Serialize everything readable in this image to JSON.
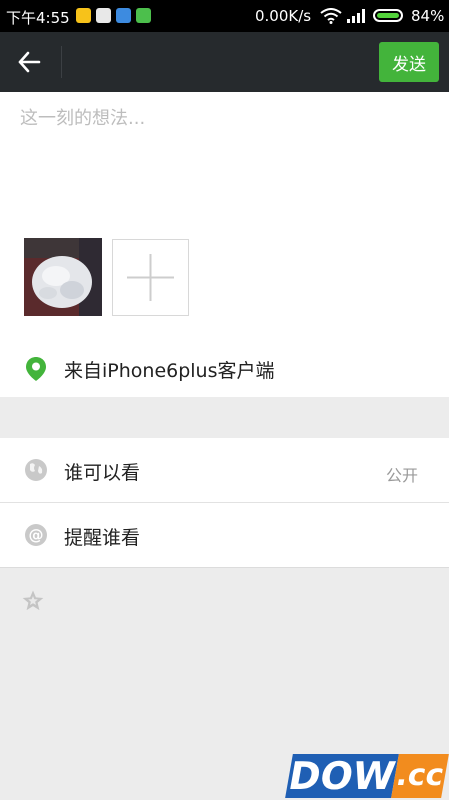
{
  "status_bar": {
    "time": "下午4:55",
    "net_speed": "0.00K/s",
    "battery": "84%",
    "notification_icons": [
      "weibo-icon",
      "qq-icon",
      "message-icon",
      "chat-icon"
    ]
  },
  "topbar": {
    "back_icon": "back-arrow-icon",
    "send_label": "发送",
    "send_color": "#43b43b"
  },
  "compose": {
    "placeholder": "这一刻的想法...",
    "photo_count": 1,
    "add_photo_icon": "plus-icon"
  },
  "location": {
    "icon": "location-pin-icon",
    "text": "来自iPhone6plus客户端"
  },
  "options": [
    {
      "icon": "globe-icon",
      "label": "谁可以看",
      "value": "公开"
    },
    {
      "icon": "at-icon",
      "label": "提醒谁看"
    }
  ],
  "extra_icon": "star-icon",
  "watermark": {
    "part1": "DOWN",
    "part2": ".cc"
  }
}
